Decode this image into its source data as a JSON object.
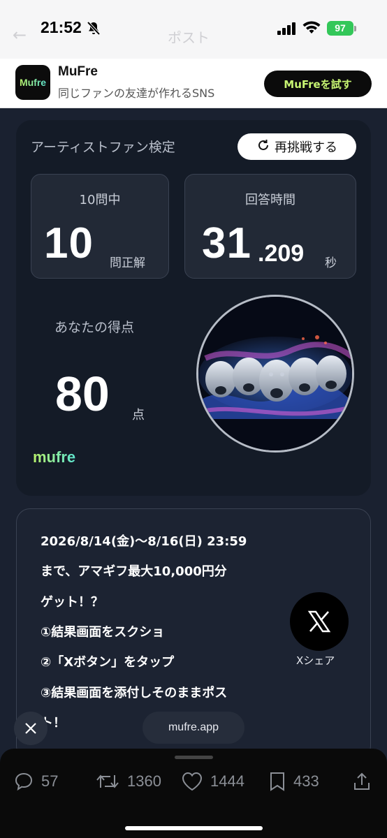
{
  "status": {
    "time": "21:52",
    "battery": "97"
  },
  "banner": {
    "app_name": "MuFre",
    "logo_text": "Mufre",
    "description": "同じファンの友達が作れるSNS",
    "try_button": "MuFreを試す"
  },
  "result": {
    "quiz_title": "アーティストファン検定",
    "retry_label": "再挑戦する",
    "questions_caption": "10問中",
    "correct_count": "10",
    "correct_unit": "問正解",
    "time_caption": "回答時間",
    "time_whole": "31",
    "time_decimal": ".209",
    "time_unit": "秒",
    "score_caption": "あなたの得点",
    "score_value": "80",
    "score_unit": "点",
    "brand_mark": "mufre"
  },
  "campaign": {
    "lines": [
      "2026/8/14(金)〜8/16(日) 23:59",
      "まで、アマギフ最大10,000円分",
      "ゲット！？",
      "①結果画面をスクショ",
      "②「Xボタン」をタップ",
      "③結果画面を添付しそのままポス",
      "ト！"
    ],
    "share_label": "Xシェア"
  },
  "overlay": {
    "url": "mufre.app"
  },
  "actions": {
    "replies": "57",
    "reposts": "1360",
    "likes": "1444",
    "bookmarks": "433"
  },
  "icons": [
    "bell-slash-icon",
    "signal-icon",
    "wifi-icon",
    "battery-icon",
    "refresh-icon",
    "x-logo-icon",
    "close-icon",
    "reply-icon",
    "repost-icon",
    "like-icon",
    "bookmark-icon",
    "share-icon"
  ],
  "colors": {
    "accent_green": "#c7f472",
    "battery_green": "#33c759",
    "card_bg": "#141b27"
  }
}
